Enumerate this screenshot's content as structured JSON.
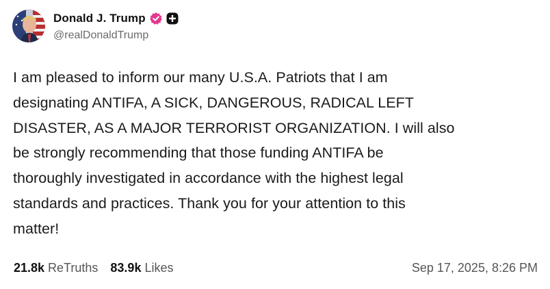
{
  "author": {
    "display_name": "Donald J. Trump",
    "handle": "@realDonaldTrump",
    "verified_color": "#e33a8f"
  },
  "post": {
    "text": "I am pleased to inform our many U.S.A. Patriots that I am\ndesignating ANTIFA, A SICK, DANGEROUS, RADICAL LEFT\nDISASTER, AS A MAJOR TERRORIST ORGANIZATION. I will also\nbe strongly recommending that those funding ANTIFA be\nthoroughly investigated in accordance with the highest legal\nstandards and practices. Thank you for your attention to this\nmatter!"
  },
  "stats": {
    "retruths_count": "21.8k",
    "retruths_label": "ReTruths",
    "likes_count": "83.9k",
    "likes_label": "Likes"
  },
  "timestamp": "Sep 17, 2025, 8:26 PM",
  "icons": {
    "verified": "verified-badge-icon",
    "plus": "plus-badge-icon",
    "avatar": "avatar"
  }
}
